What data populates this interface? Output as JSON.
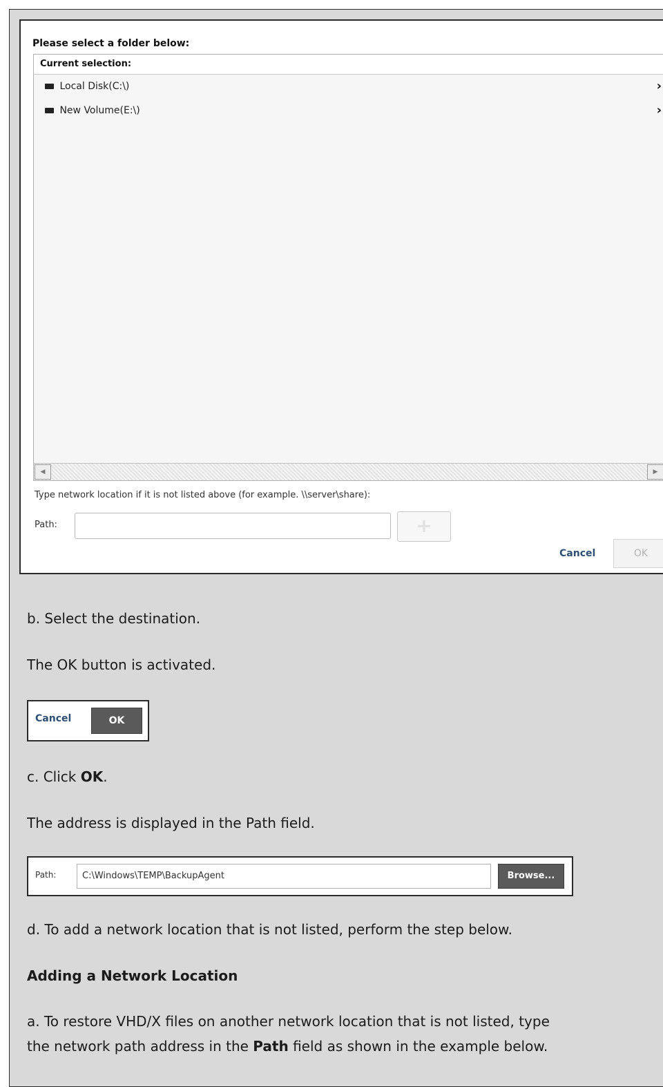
{
  "dialog": {
    "title": "Please select a folder below:",
    "current_selection_label": "Current selection:",
    "folders": [
      {
        "label": "Local Disk(C:\\)",
        "icon": "drive-icon",
        "expand_icon": "chevron-right-icon"
      },
      {
        "label": "New Volume(E:\\)",
        "icon": "drive-icon",
        "expand_icon": "chevron-right-icon"
      }
    ],
    "network_hint": "Type network location if it is not listed above (for example. \\\\server\\share):",
    "path_label": "Path:",
    "path_value": "",
    "add_button": "+",
    "cancel_label": "Cancel",
    "ok_label": "OK"
  },
  "steps": {
    "b_select": "b. Select the destination.",
    "ok_activated": "The OK button is activated.",
    "c_click_prefix": "c. Click ",
    "c_click_bold": "OK",
    "c_click_suffix": ".",
    "address_displayed": "The address is displayed in the Path field.",
    "d_add_network": "d. To add a network location that is not listed, perform the step below.",
    "adding_heading": "Adding a Network Location",
    "a_restore_line1": "a. To restore VHD/X files on another network location that is not listed, type",
    "a_restore_line2_prefix": "the network path address in the ",
    "a_restore_line2_bold": "Path",
    "a_restore_line2_suffix": " field as shown in the example below."
  },
  "button_snippet": {
    "cancel_label": "Cancel",
    "ok_label": "OK"
  },
  "path_snippet": {
    "label": "Path:",
    "value": "C:\\Windows\\TEMP\\BackupAgent",
    "browse_label": "Browse..."
  },
  "colors": {
    "page_background": "#d9d9d9",
    "link_blue": "#2d4f72",
    "active_button": "#5a5a5a"
  }
}
